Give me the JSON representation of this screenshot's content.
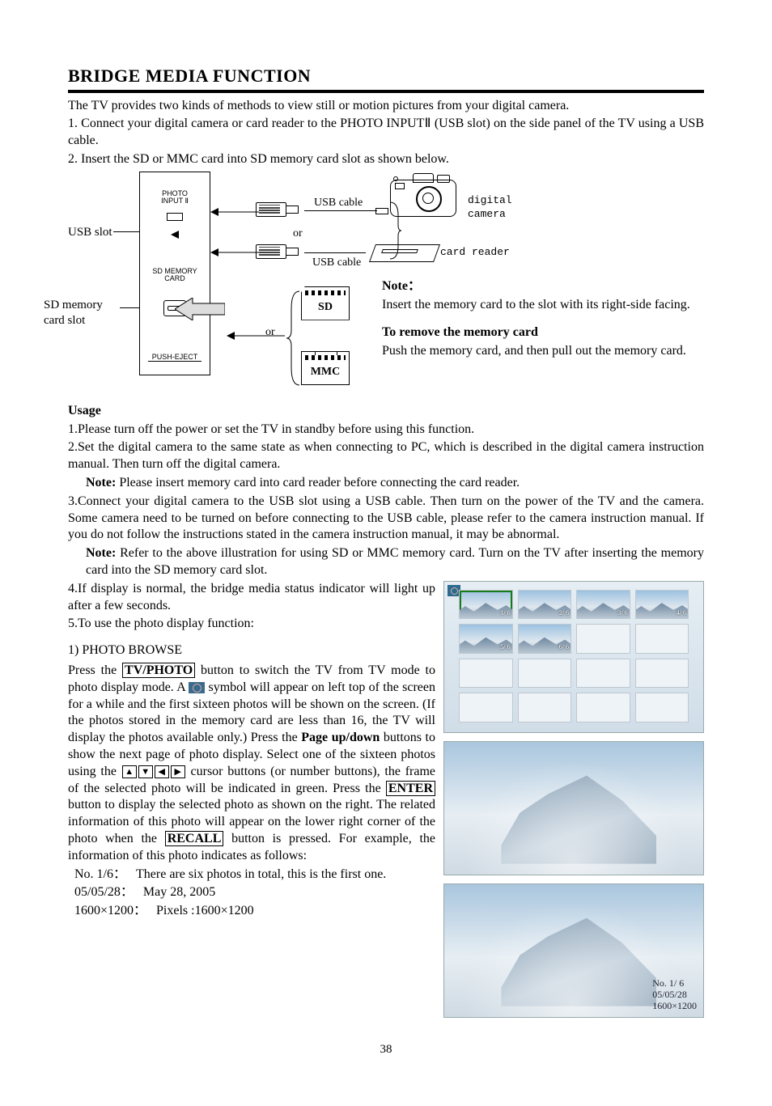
{
  "page_number": "38",
  "title": "BRIDGE MEDIA FUNCTION",
  "intro": "The TV provides two kinds of methods to view still or motion pictures from your digital camera.",
  "intro_items": [
    "1. Connect your digital camera or card reader to the PHOTO INPUTⅡ (USB slot) on the side panel of the TV using a USB cable.",
    "2. Insert the SD or MMC card into SD memory card slot as shown below."
  ],
  "diagram": {
    "usb_slot_label": "USB slot",
    "sd_slot_label": "SD memory card slot",
    "panel_photo_input": "PHOTO\nINPUT Ⅱ",
    "panel_sd_memory": "SD MEMORY\nCARD",
    "panel_push_eject": "PUSH-EJECT",
    "usb_cable": "USB cable",
    "or": "or",
    "digital_camera": "digital\ncamera",
    "card_reader": "card reader",
    "sd_label": "SD",
    "mmc_label": "MMC",
    "note_heading": "Note：",
    "note_text": "Insert the memory card to the slot with its right-side facing.",
    "remove_heading": "To remove the memory card",
    "remove_text": "Push the memory card, and then pull out the memory card."
  },
  "usage": {
    "heading": "Usage",
    "items": [
      "1.Please turn off the power or set the TV in standby before using this function.",
      "2.Set the digital camera to the same state as when connecting to PC, which is described in the digital camera instruction manual. Then turn off the digital camera.",
      "3.Connect your digital camera to the USB slot using a USB cable. Then turn on the power of the TV and the camera. Some camera need to be turned on before connecting to the USB cable, please refer to the camera instruction manual. If you do not follow the instructions stated in the camera instruction manual, it may be abnormal.",
      "4.If display is normal, the bridge media status indicator will light up after a few seconds.",
      "5.To use the photo display function:"
    ],
    "note2_label": "Note:",
    "note2_text": " Please insert memory card into card reader before connecting the card reader.",
    "note3_label": "Note:",
    "note3_text": " Refer to the above illustration for using SD or MMC memory card. Turn on the TV after inserting the memory card into the SD memory card slot."
  },
  "photo_browse": {
    "heading": "1) PHOTO BROWSE",
    "p1_a": "Press the ",
    "btn_tvphoto": "TV/PHOTO",
    "p1_b": " button to switch the TV from TV mode to photo display mode. A ",
    "p1_c": " symbol will appear on left top of the screen for a while and the first sixteen photos will be shown on the screen. (If the photos stored in the memory card are less than 16, the TV will display the photos available only.) Press the ",
    "bold_pageupdown": "Page up/down",
    "p1_d": " buttons to show the next page of photo display. Select one of the sixteen photos using the ",
    "p1_e": " cursor buttons (or number buttons), the frame of the selected photo will be indicated in green. Press the ",
    "btn_enter": "ENTER",
    "p1_f": " button to display the selected photo as shown on the right. The related information of this photo will appear on the lower right corner of the photo when the ",
    "btn_recall": "RECALL",
    "p1_g": " button is pressed. For example, the information of this photo indicates as follows:",
    "info": [
      {
        "k": "No. 1/6：",
        "v": "There are six photos in total, this is the first one."
      },
      {
        "k": "05/05/28：",
        "v": "May 28, 2005"
      },
      {
        "k": "1600×1200：",
        "v": "Pixels :1600×1200"
      }
    ]
  },
  "thumbnails": {
    "badges": [
      "1/ 6",
      "2/ 6",
      "3/ 6",
      "4/ 6",
      "5/ 6",
      "6/ 6"
    ]
  },
  "big_photo_info": {
    "line1": "No.   1/  6",
    "line2": "05/05/28",
    "line3": "1600×1200"
  }
}
